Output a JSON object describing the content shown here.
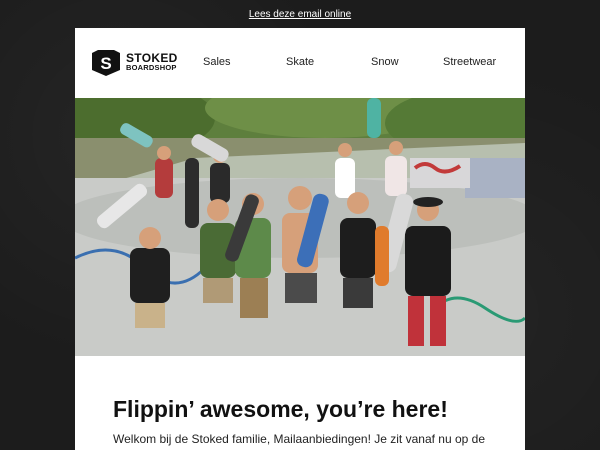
{
  "topbar": {
    "online_link": "Lees deze email online"
  },
  "logo": {
    "badge_letter": "S",
    "line1": "STOKED",
    "line2": "BOARDSHOP"
  },
  "nav": {
    "items": [
      {
        "label": "Sales"
      },
      {
        "label": "Skate"
      },
      {
        "label": "Snow"
      },
      {
        "label": "Streetwear"
      }
    ]
  },
  "hero": {
    "subject": "group of skateboarders raising skateboards in a skatepark"
  },
  "content": {
    "headline": "Flippin’ awesome, you’re here!",
    "intro": "Welkom bij de Stoked familie, Mailaanbiedingen! Je zit vanaf nu op de"
  },
  "colors": {
    "page_bg": "#1c1c1c",
    "card_bg": "#ffffff",
    "text": "#111111"
  }
}
